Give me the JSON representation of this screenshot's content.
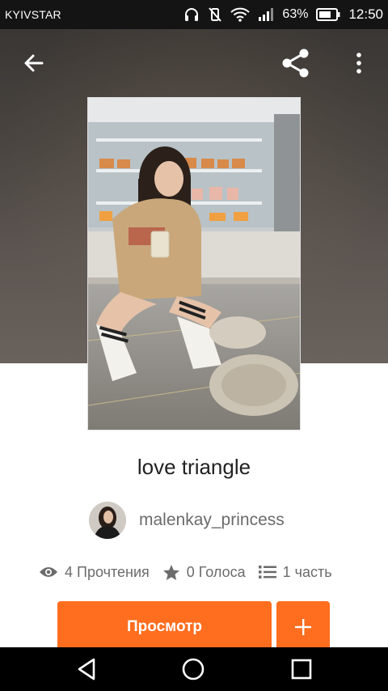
{
  "status_bar": {
    "carrier": "KYIVSTAR",
    "battery_percent": "63%",
    "time": "12:50",
    "icons": [
      "headphones-icon",
      "vibrate-off-icon",
      "wifi-icon",
      "signal-icon",
      "battery-icon"
    ]
  },
  "toolbar": {
    "back_icon": "arrow-back-icon",
    "share_icon": "share-icon",
    "more_icon": "more-vertical-icon"
  },
  "story": {
    "title": "love triangle",
    "author": "malenkay_princess",
    "stats": {
      "reads": "4 Прочтения",
      "votes": "0 Голоса",
      "parts": "1 часть"
    }
  },
  "actions": {
    "read_label": "Просмотр",
    "add_icon": "plus-icon"
  },
  "nav": {
    "back_icon": "nav-back-icon",
    "home_icon": "nav-home-icon",
    "recents_icon": "nav-recents-icon"
  },
  "colors": {
    "accent": "#ff6d1f",
    "text_primary": "#222222",
    "text_secondary": "#6b6b6b"
  }
}
